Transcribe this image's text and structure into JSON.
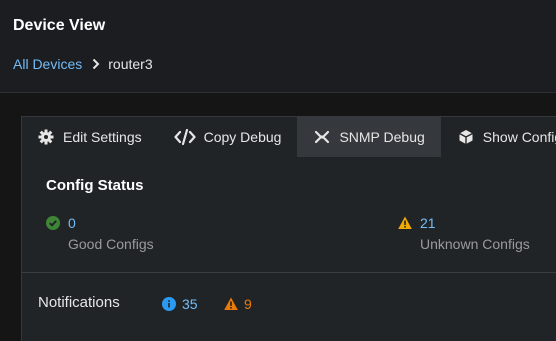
{
  "header": {
    "title": "Device View",
    "breadcrumb": {
      "link": "All Devices",
      "current": "router3"
    }
  },
  "tabs": [
    {
      "label": "Edit Settings",
      "icon": "gear-icon"
    },
    {
      "label": "Copy Debug",
      "icon": "code-icon"
    },
    {
      "label": "SNMP Debug",
      "icon": "snmp-icon",
      "active": true
    },
    {
      "label": "Show Config",
      "icon": "cube-icon"
    }
  ],
  "config_status": {
    "title": "Config Status",
    "good": {
      "count": "0",
      "label": "Good Configs",
      "icon": "check-circle-icon",
      "color": "#3e8635"
    },
    "unknown": {
      "count": "21",
      "label": "Unknown Configs",
      "icon": "warning-icon",
      "color": "#f0ab00"
    }
  },
  "notifications": {
    "title": "Notifications",
    "info": {
      "count": "35",
      "icon": "info-circle-icon",
      "color": "#2b9af3"
    },
    "warning": {
      "count": "9",
      "icon": "warning-icon",
      "color": "#ec7a08"
    }
  },
  "colors": {
    "link": "#73bcf7",
    "background": "#151515",
    "card": "#212427"
  }
}
